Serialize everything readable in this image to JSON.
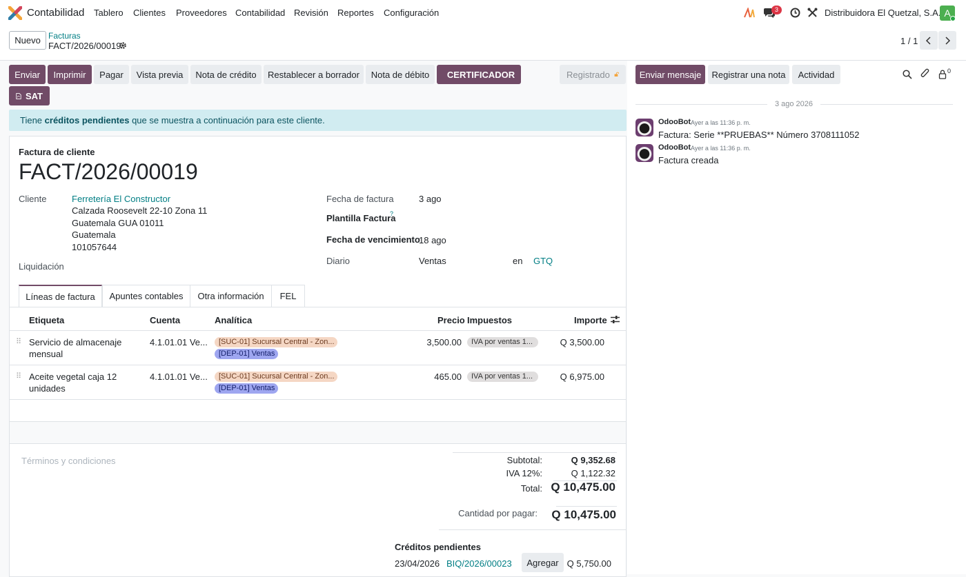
{
  "navbar": {
    "app_name": "Contabilidad",
    "menus": [
      "Tablero",
      "Clientes",
      "Proveedores",
      "Contabilidad",
      "Revisión",
      "Reportes",
      "Configuración"
    ],
    "messages_badge": "3",
    "company": "Distribuidora El Quetzal, S.A.",
    "user_initial": "A"
  },
  "control_panel": {
    "new_button": "Nuevo",
    "breadcrumb_parent": "Facturas",
    "breadcrumb_current": "FACT/2026/00019",
    "pager": "1 / 1"
  },
  "actions": {
    "buttons_primary": [
      "Enviar",
      "Imprimir"
    ],
    "buttons_secondary": [
      "Pagar",
      "Vista previa",
      "Nota de crédito",
      "Restablecer a borrador",
      "Nota de débito"
    ],
    "certificador": "CERTIFICADOR",
    "sat": "SAT",
    "status": "Registrado"
  },
  "alert": {
    "prefix": "Tiene ",
    "strong": "créditos pendientes",
    "suffix": " que se muestra a continuación para este cliente."
  },
  "form": {
    "type_label": "Factura de cliente",
    "number": "FACT/2026/00019",
    "customer_label": "Cliente",
    "customer_name": "Ferretería El Constructor",
    "address_lines": [
      "Calzada Roosevelt 22-10 Zona 11",
      "Guatemala GUA 01011",
      "Guatemala",
      "101057644"
    ],
    "liquidation_label": "Liquidación",
    "invoice_date_label": "Fecha de factura",
    "invoice_date": "3 ago",
    "template_label": "Plantilla Factura",
    "template_help": "?",
    "due_date_label": "Fecha de vencimiento",
    "due_date": "18 ago",
    "journal_label": "Diario",
    "journal": "Ventas",
    "currency_prefix": "en",
    "currency": "GTQ"
  },
  "tabs": [
    "Líneas de factura",
    "Apuntes contables",
    "Otra información",
    "FEL"
  ],
  "table": {
    "headers": {
      "label": "Etiqueta",
      "account": "Cuenta",
      "analytic": "Analítica",
      "price": "Precio",
      "taxes": "Impuestos",
      "amount": "Importe"
    },
    "rows": [
      {
        "label_1": "Servicio de almacenaje",
        "label_2": "mensual",
        "account": "4.1.01.01 Ve...",
        "analytic_1": "[SUC-01] Sucursal Central - Zon...",
        "analytic_2": "[DEP-01] Ventas",
        "price": "3,500.00",
        "tax": "IVA por ventas 1...",
        "amount": "Q 3,500.00"
      },
      {
        "label_1": "Aceite vegetal caja 12",
        "label_2": "unidades",
        "account": "4.1.01.01 Ve...",
        "analytic_1": "[SUC-01] Sucursal Central - Zon...",
        "analytic_2": "[DEP-01] Ventas",
        "price": "465.00",
        "tax": "IVA por ventas 1...",
        "amount": "Q 6,975.00"
      }
    ]
  },
  "terms_placeholder": "Términos y condiciones",
  "totals": {
    "subtotal_label": "Subtotal:",
    "subtotal": "Q 9,352.68",
    "iva_label": "IVA 12%:",
    "iva": "Q 1,122.32",
    "total_label": "Total:",
    "total": "Q 10,475.00",
    "due_label": "Cantidad por pagar:",
    "due": "Q 10,475.00"
  },
  "credits": {
    "title": "Créditos pendientes",
    "date": "23/04/2026",
    "reference": "BIQ/2026/00023",
    "add_button": "Agregar",
    "amount": "Q 5,750.00"
  },
  "chatter": {
    "send_message": "Enviar mensaje",
    "log_note": "Registrar una nota",
    "activity": "Actividad",
    "followers_count": "0",
    "date_separator": "3 ago 2026",
    "messages": [
      {
        "author": "OdooBot",
        "time": "Ayer a las 11:36 p. m.",
        "body": "Factura: Serie **PRUEBAS** Número 3708111052"
      },
      {
        "author": "OdooBot",
        "time": "Ayer a las 11:36 p. m.",
        "body": "Factura creada"
      }
    ]
  },
  "colors": {
    "primary": "#714b67",
    "link": "#017e84",
    "alert_bg": "#d1ecf1"
  }
}
